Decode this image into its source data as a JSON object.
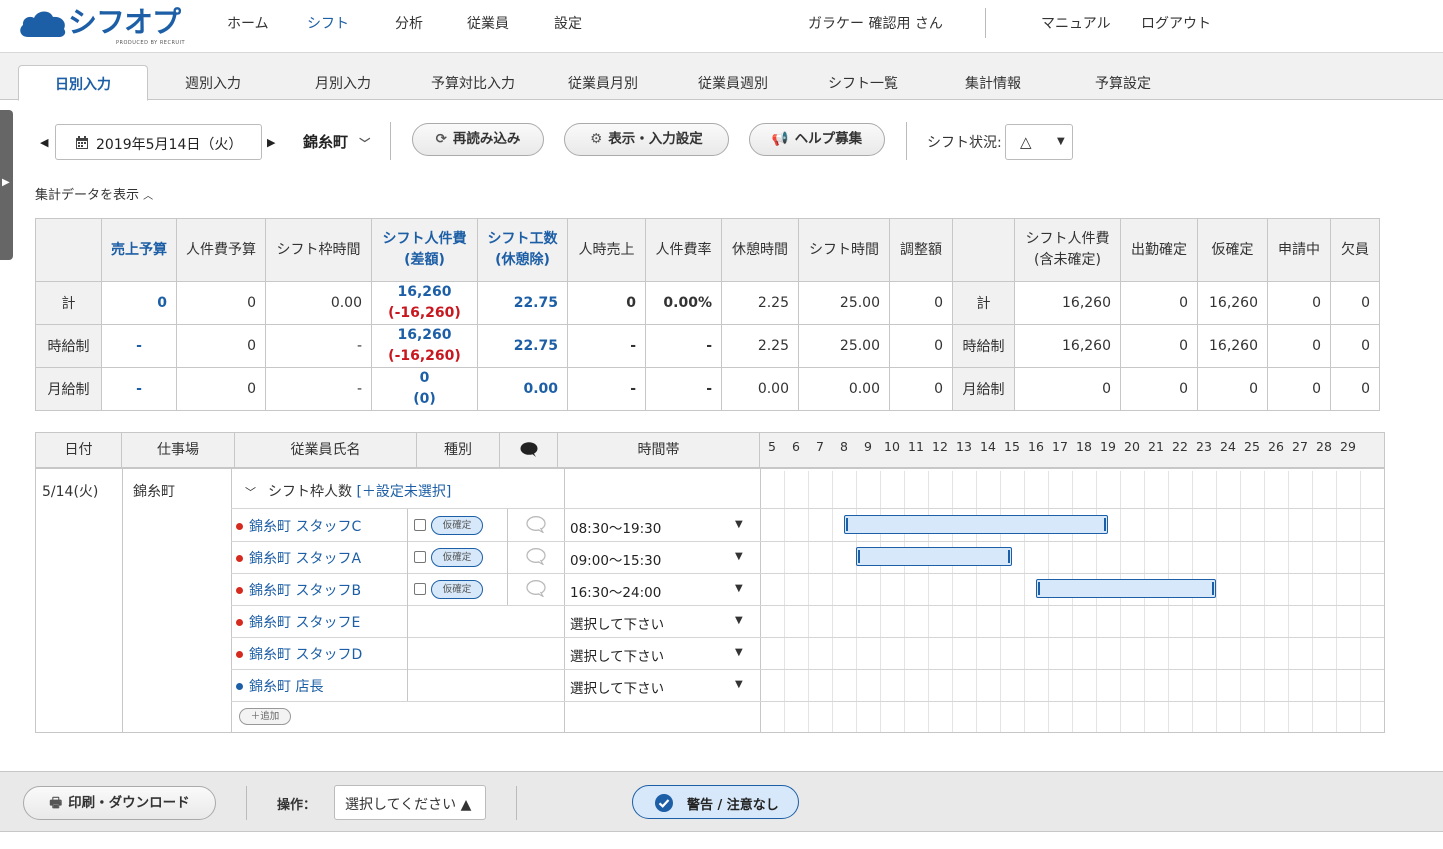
{
  "header": {
    "brand": "シフオプ",
    "brand_sub": "PRODUCED BY RECRUIT",
    "nav": [
      "ホーム",
      "シフト",
      "分析",
      "従業員",
      "設定"
    ],
    "user": "ガラケー 確認用 さん",
    "manual": "マニュアル",
    "logout": "ログアウト"
  },
  "tabs": [
    "日別入力",
    "週別入力",
    "月別入力",
    "予算対比入力",
    "従業員月別",
    "従業員週別",
    "シフト一覧",
    "集計情報",
    "予算設定"
  ],
  "toolbar": {
    "date": "2019年5月14日（火）",
    "store": "錦糸町",
    "reload": "再読み込み",
    "display_settings": "表示・入力設定",
    "help_recruit": "ヘルプ募集",
    "shift_status_label": "シフト状況:",
    "shift_status_value": "△",
    "toggle_summary": "集計データを表示"
  },
  "summary": {
    "headers": [
      "",
      "売上予算",
      "人件費予算",
      "シフト枠時間",
      "シフト人件費",
      "(差額)",
      "シフト工数",
      "(休憩除)",
      "人時売上",
      "人件費率",
      "休憩時間",
      "シフト時間",
      "調整額",
      "",
      "シフト人件費",
      "(含未確定)",
      "出勤確定",
      "仮確定",
      "申請中",
      "欠員"
    ],
    "rows": [
      {
        "label": "計",
        "sales_budget": "0",
        "labor_budget": "0",
        "frame_time": "0.00",
        "labor_cost": "16,260",
        "labor_diff": "(-16,260)",
        "man_hours": "22.75",
        "sales_per_hour": "0",
        "labor_rate": "0.00%",
        "break_time": "2.25",
        "shift_time": "25.00",
        "adjust": "0",
        "label2": "計",
        "cost_incl": "16,260",
        "confirmed": "0",
        "provisional": "16,260",
        "applying": "0",
        "vacancy": "0"
      },
      {
        "label": "時給制",
        "sales_budget": "-",
        "labor_budget": "0",
        "frame_time": "-",
        "labor_cost": "16,260",
        "labor_diff": "(-16,260)",
        "man_hours": "22.75",
        "sales_per_hour": "-",
        "labor_rate": "-",
        "break_time": "2.25",
        "shift_time": "25.00",
        "adjust": "0",
        "label2": "時給制",
        "cost_incl": "16,260",
        "confirmed": "0",
        "provisional": "16,260",
        "applying": "0",
        "vacancy": "0"
      },
      {
        "label": "月給制",
        "sales_budget": "-",
        "labor_budget": "0",
        "frame_time": "-",
        "labor_cost": "0",
        "labor_diff": "(0)",
        "man_hours": "0.00",
        "sales_per_hour": "-",
        "labor_rate": "-",
        "break_time": "0.00",
        "shift_time": "0.00",
        "adjust": "0",
        "label2": "月給制",
        "cost_incl": "0",
        "confirmed": "0",
        "provisional": "0",
        "applying": "0",
        "vacancy": "0"
      }
    ]
  },
  "shift_table": {
    "headers": {
      "date": "日付",
      "workplace": "仕事場",
      "employee": "従業員氏名",
      "type": "種別",
      "timeslot": "時間帯"
    },
    "hours": [
      "5",
      "6",
      "7",
      "8",
      "9",
      "10",
      "11",
      "12",
      "13",
      "14",
      "15",
      "16",
      "17",
      "18",
      "19",
      "20",
      "21",
      "22",
      "23",
      "24",
      "25",
      "26",
      "27",
      "28",
      "29"
    ],
    "date": "5/14(火)",
    "workplace": "錦糸町",
    "frame_row": "シフト枠人数",
    "frame_link": "[＋設定未選択]",
    "employees": [
      {
        "name": "錦糸町 スタッフC",
        "dot": "#d52b1e",
        "badge": "仮確定",
        "time": "08:30～19:30",
        "start": 8.5,
        "end": 19.5
      },
      {
        "name": "錦糸町 スタッフA",
        "dot": "#d52b1e",
        "badge": "仮確定",
        "time": "09:00～15:30",
        "start": 9.0,
        "end": 15.5
      },
      {
        "name": "錦糸町 スタッフB",
        "dot": "#d52b1e",
        "badge": "仮確定",
        "time": "16:30～24:00",
        "start": 16.5,
        "end": 24.0
      },
      {
        "name": "錦糸町 スタッフE",
        "dot": "#d52b1e",
        "badge": "",
        "time": "選択して下さい"
      },
      {
        "name": "錦糸町 スタッフD",
        "dot": "#d52b1e",
        "badge": "",
        "time": "選択して下さい"
      },
      {
        "name": "錦糸町 店長",
        "dot": "#1d5fa6",
        "badge": "",
        "time": "選択して下さい"
      }
    ],
    "add_label": "＋追加"
  },
  "footer": {
    "print": "印刷・ダウンロード",
    "operation_label": "操作：",
    "operation_value": "選択してください ▲",
    "warning": "警告 / 注意なし"
  },
  "colors": {
    "accent": "#1d5fa6",
    "red": "#c8171e",
    "bar_fill": "#d6e8f9"
  }
}
